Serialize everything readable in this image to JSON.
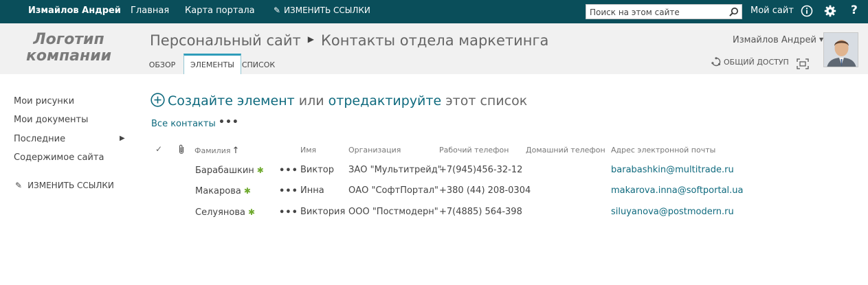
{
  "suite_bar": {
    "user": "Измайлов Андрей",
    "links": [
      "Главная",
      "Карта портала"
    ],
    "edit_links": "ИЗМЕНИТЬ ССЫЛКИ",
    "search_placeholder": "Поиск на этом сайте",
    "my_site": "Мой сайт",
    "icons": [
      "info-icon",
      "gear-icon",
      "help-icon"
    ],
    "bg_color": "#0a4e5a"
  },
  "header": {
    "logo_line1": "Логотип",
    "logo_line2": "компании",
    "breadcrumb_site": "Персональный сайт",
    "breadcrumb_page": "Контакты отдела маркетинга",
    "tabs": [
      "ОБЗОР",
      "ЭЛЕМЕНТЫ",
      "СПИСОК"
    ],
    "active_tab": "ЭЛЕМЕНТЫ",
    "user_menu": "Измайлов Андрей",
    "share": "ОБЩИЙ ДОСТУП"
  },
  "left_nav": {
    "items": [
      "Мои рисунки",
      "Мои документы",
      "Последние",
      "Содержимое сайта"
    ],
    "edit_links": "ИЗМЕНИТЬ ССЫЛКИ"
  },
  "main": {
    "create_link": "Создайте элемент",
    "create_or": "или",
    "edit_link": "отредактируйте",
    "create_tail": "этот список",
    "view_name": "Все контакты",
    "ellipsis": "•••",
    "columns": [
      "Фамилия",
      "Имя",
      "Организация",
      "Рабочий телефон",
      "Домашний телефон",
      "Адрес электронной почты"
    ],
    "sort_indicator": "↑",
    "rows": [
      {
        "last": "Барабашкин",
        "first": "Виктор",
        "org": "ЗАО \"Мультитрейд\"",
        "work": "+7(945)456-32-12",
        "home": "",
        "email": "barabashkin@multitrade.ru"
      },
      {
        "last": "Макарова",
        "first": "Инна",
        "org": "ОАО \"СофтПортал\"",
        "work": "+380 (44) 208-0304",
        "home": "",
        "email": "makarova.inna@softportal.ua"
      },
      {
        "last": "Селуянова",
        "first": "Виктория",
        "org": "ООО \"Постмодерн\"",
        "work": "+7(4885) 564-398",
        "home": "",
        "email": "siluyanova@postmodern.ru"
      }
    ],
    "new_badge": "✱",
    "link_color": "#0f6a7e"
  }
}
